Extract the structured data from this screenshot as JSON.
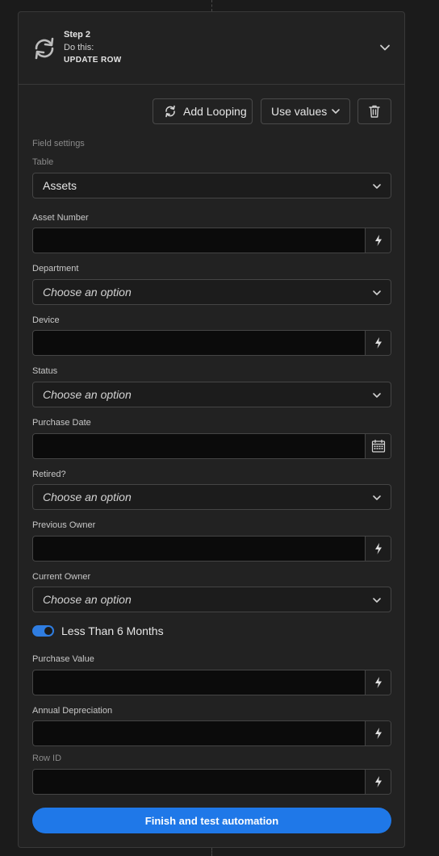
{
  "step": {
    "label": "Step 2",
    "do_this": "Do this:",
    "action": "UPDATE ROW"
  },
  "toolbar": {
    "add_looping": "Add Looping",
    "use_values": "Use values"
  },
  "section_heading": "Field settings",
  "table": {
    "label": "Table",
    "value": "Assets"
  },
  "fields": {
    "asset_number": {
      "label": "Asset Number",
      "value": ""
    },
    "department": {
      "label": "Department",
      "placeholder": "Choose an option"
    },
    "device": {
      "label": "Device",
      "value": ""
    },
    "status": {
      "label": "Status",
      "placeholder": "Choose an option"
    },
    "purchase_date": {
      "label": "Purchase Date",
      "value": ""
    },
    "retired": {
      "label": "Retired?",
      "placeholder": "Choose an option"
    },
    "previous_owner": {
      "label": "Previous Owner",
      "value": ""
    },
    "current_owner": {
      "label": "Current Owner",
      "placeholder": "Choose an option"
    },
    "purchase_value": {
      "label": "Purchase Value",
      "value": ""
    },
    "annual_depreciation": {
      "label": "Annual Depreciation",
      "value": ""
    },
    "row_id": {
      "label": "Row ID",
      "value": ""
    }
  },
  "toggle": {
    "label": "Less Than 6 Months",
    "on": true
  },
  "finish_button": "Finish and test automation",
  "colors": {
    "accent": "#1f78e8",
    "toggle": "#2f7de1",
    "background": "#1b1b1b",
    "card": "#222222"
  },
  "icons": {
    "step": "refresh-icon",
    "collapse": "chevron-down-icon",
    "looping": "loop-icon",
    "delete": "trash-icon",
    "binding": "lightning-icon",
    "date": "calendar-icon"
  }
}
